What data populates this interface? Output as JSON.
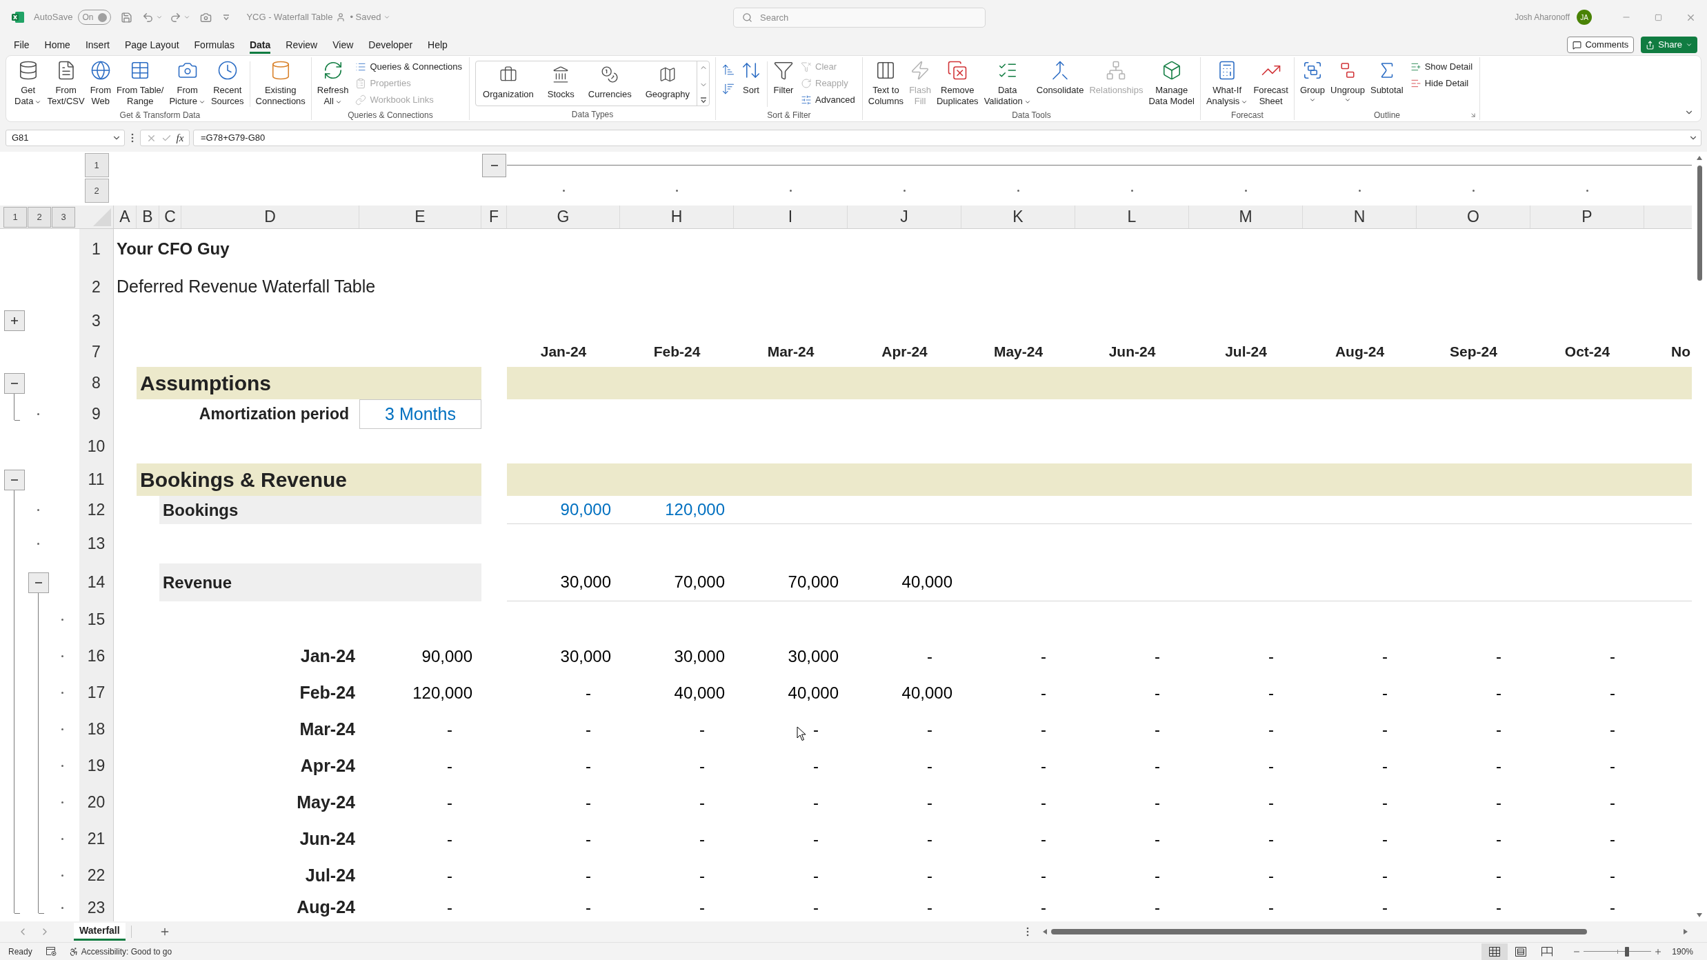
{
  "title_bar": {
    "autosave": {
      "label": "AutoSave",
      "state_text": "On",
      "on": true
    },
    "document_title": "YCG - Waterfall Table",
    "save_status": "• Saved",
    "search": {
      "placeholder": "Search"
    },
    "user_name": "Josh Aharonoff",
    "avatar_initials": "JA"
  },
  "menu_tabs": [
    {
      "label": "File",
      "selected": false
    },
    {
      "label": "Home",
      "selected": false
    },
    {
      "label": "Insert",
      "selected": false
    },
    {
      "label": "Page Layout",
      "selected": false
    },
    {
      "label": "Formulas",
      "selected": false
    },
    {
      "label": "Data",
      "selected": true
    },
    {
      "label": "Review",
      "selected": false
    },
    {
      "label": "View",
      "selected": false
    },
    {
      "label": "Developer",
      "selected": false
    },
    {
      "label": "Help",
      "selected": false
    }
  ],
  "header_buttons": {
    "comments": "Comments",
    "share": "Share"
  },
  "ribbon": {
    "groups": [
      {
        "label": "Get & Transform Data",
        "items": [
          {
            "kind": "large",
            "lines": [
              "Get",
              "Data"
            ],
            "dropdown": true,
            "disabled": false
          },
          {
            "kind": "large",
            "lines": [
              "From",
              "Text/CSV"
            ],
            "dropdown": false,
            "disabled": false
          },
          {
            "kind": "large",
            "lines": [
              "From",
              "Web"
            ],
            "dropdown": false,
            "disabled": false
          },
          {
            "kind": "large",
            "lines": [
              "From Table/",
              "Range"
            ],
            "dropdown": false,
            "disabled": false
          },
          {
            "kind": "large",
            "lines": [
              "From",
              "Picture"
            ],
            "dropdown": true,
            "disabled": false
          },
          {
            "kind": "large",
            "lines": [
              "Recent",
              "Sources"
            ],
            "dropdown": false,
            "disabled": false
          },
          {
            "kind": "separator"
          },
          {
            "kind": "large",
            "lines": [
              "Existing",
              "Connections"
            ],
            "dropdown": false,
            "disabled": false
          }
        ]
      },
      {
        "label": "Queries & Connections",
        "items": [
          {
            "kind": "large",
            "lines": [
              "Refresh",
              "All"
            ],
            "dropdown": true,
            "disabled": false
          },
          {
            "kind": "small_stack",
            "entries": [
              {
                "label": "Queries & Connections",
                "disabled": false
              },
              {
                "label": "Properties",
                "disabled": true
              },
              {
                "label": "Workbook Links",
                "disabled": true
              }
            ]
          }
        ]
      },
      {
        "label": "Data Types",
        "items": [
          {
            "kind": "gallery",
            "entries": [
              "Organization",
              "Stocks",
              "Currencies",
              "Geography"
            ]
          }
        ]
      },
      {
        "label": "Sort & Filter",
        "items": [
          {
            "kind": "sort_pair"
          },
          {
            "kind": "large",
            "lines": [
              "Sort"
            ],
            "dropdown": false,
            "disabled": false
          },
          {
            "kind": "separator"
          },
          {
            "kind": "large",
            "lines": [
              "Filter"
            ],
            "dropdown": false,
            "disabled": false
          },
          {
            "kind": "small_stack",
            "entries": [
              {
                "label": "Clear",
                "disabled": true
              },
              {
                "label": "Reapply",
                "disabled": true
              },
              {
                "label": "Advanced",
                "disabled": false
              }
            ]
          }
        ]
      },
      {
        "label": "Data Tools",
        "items": [
          {
            "kind": "large",
            "lines": [
              "Text to",
              "Columns"
            ],
            "dropdown": false,
            "disabled": false
          },
          {
            "kind": "large",
            "lines": [
              "Flash",
              "Fill"
            ],
            "dropdown": false,
            "disabled": true
          },
          {
            "kind": "large",
            "lines": [
              "Remove",
              "Duplicates"
            ],
            "dropdown": false,
            "disabled": false
          },
          {
            "kind": "large",
            "lines": [
              "Data",
              "Validation"
            ],
            "dropdown": true,
            "disabled": false
          },
          {
            "kind": "large",
            "lines": [
              "Consolidate"
            ],
            "dropdown": false,
            "disabled": false
          },
          {
            "kind": "large",
            "lines": [
              "Relationships"
            ],
            "dropdown": false,
            "disabled": true
          },
          {
            "kind": "large",
            "lines": [
              "Manage",
              "Data Model"
            ],
            "dropdown": false,
            "disabled": false
          }
        ]
      },
      {
        "label": "Forecast",
        "items": [
          {
            "kind": "large",
            "lines": [
              "What-If",
              "Analysis"
            ],
            "dropdown": true,
            "disabled": false
          },
          {
            "kind": "large",
            "lines": [
              "Forecast",
              "Sheet"
            ],
            "dropdown": false,
            "disabled": false
          }
        ]
      },
      {
        "label": "Outline",
        "dialog_launcher": true,
        "items": [
          {
            "kind": "large",
            "lines": [
              "Group"
            ],
            "dropdown": true,
            "disabled": false
          },
          {
            "kind": "large",
            "lines": [
              "Ungroup"
            ],
            "dropdown": true,
            "disabled": false
          },
          {
            "kind": "large",
            "lines": [
              "Subtotal"
            ],
            "dropdown": false,
            "disabled": false
          },
          {
            "kind": "small_stack",
            "entries": [
              {
                "label": "Show Detail",
                "disabled": false
              },
              {
                "label": "Hide Detail",
                "disabled": false
              }
            ]
          }
        ]
      }
    ]
  },
  "formula_bar": {
    "name_box": "G81",
    "function_label": "fx",
    "formula": "=G78+G79-G80"
  },
  "sheet": {
    "row_levels": [
      "1",
      "2",
      "3"
    ],
    "column_levels": [
      "1",
      "2"
    ],
    "columns": [
      {
        "label": "A"
      },
      {
        "label": "B"
      },
      {
        "label": "C"
      },
      {
        "label": "D"
      },
      {
        "label": "E"
      },
      {
        "label": "F",
        "expanded": true,
        "children": [
          {
            "label": "G"
          },
          {
            "label": "H"
          },
          {
            "label": "I"
          },
          {
            "label": "J"
          },
          {
            "label": "K"
          },
          {
            "label": "L"
          },
          {
            "label": "M"
          },
          {
            "label": "N"
          },
          {
            "label": "O"
          },
          {
            "label": "P"
          }
        ]
      }
    ],
    "rows": [
      {
        "number": "1",
        "kind": "title",
        "text": "Your CFO Guy"
      },
      {
        "number": "2",
        "kind": "subtitle",
        "text": "Deferred Revenue Waterfall Table"
      },
      {
        "number": "3",
        "kind": "blank",
        "expanded": false
      },
      {
        "number": "7",
        "kind": "months",
        "months": [
          "Jan-24",
          "Feb-24",
          "Mar-24",
          "Apr-24",
          "May-24",
          "Jun-24",
          "Jul-24",
          "Aug-24",
          "Sep-24",
          "Oct-24",
          "No"
        ]
      },
      {
        "number": "8",
        "kind": "section",
        "label": "Assumptions",
        "expanded": true,
        "children": [
          {
            "number": "9",
            "kind": "input",
            "label": "Amortization period",
            "value": "3 Months"
          }
        ]
      },
      {
        "number": "10",
        "kind": "blank"
      },
      {
        "number": "11",
        "kind": "section",
        "label": "Bookings & Revenue",
        "expanded": true,
        "children": [
          {
            "number": "12",
            "kind": "bookings",
            "label": "Bookings",
            "values": [
              "90,000",
              "120,000"
            ]
          },
          {
            "number": "13",
            "kind": "blank"
          },
          {
            "number": "14",
            "kind": "revenue",
            "label": "Revenue",
            "values": [
              "30,000",
              "70,000",
              "70,000",
              "40,000"
            ],
            "expanded": true,
            "children": [
              {
                "number": "15",
                "kind": "blank"
              },
              {
                "number": "16",
                "kind": "schedule",
                "label": "Jan-24",
                "booking": "90,000",
                "values": [
                  "30,000",
                  "30,000",
                  "30,000",
                  "-",
                  "-",
                  "-",
                  "-",
                  "-",
                  "-",
                  "-"
                ]
              },
              {
                "number": "17",
                "kind": "schedule",
                "label": "Feb-24",
                "booking": "120,000",
                "values": [
                  "-",
                  "40,000",
                  "40,000",
                  "40,000",
                  "-",
                  "-",
                  "-",
                  "-",
                  "-",
                  "-"
                ]
              },
              {
                "number": "18",
                "kind": "schedule",
                "label": "Mar-24",
                "booking": "-",
                "values": [
                  "-",
                  "-",
                  "-",
                  "-",
                  "-",
                  "-",
                  "-",
                  "-",
                  "-",
                  "-"
                ]
              },
              {
                "number": "19",
                "kind": "schedule",
                "label": "Apr-24",
                "booking": "-",
                "values": [
                  "-",
                  "-",
                  "-",
                  "-",
                  "-",
                  "-",
                  "-",
                  "-",
                  "-",
                  "-"
                ]
              },
              {
                "number": "20",
                "kind": "schedule",
                "label": "May-24",
                "booking": "-",
                "values": [
                  "-",
                  "-",
                  "-",
                  "-",
                  "-",
                  "-",
                  "-",
                  "-",
                  "-",
                  "-"
                ]
              },
              {
                "number": "21",
                "kind": "schedule",
                "label": "Jun-24",
                "booking": "-",
                "values": [
                  "-",
                  "-",
                  "-",
                  "-",
                  "-",
                  "-",
                  "-",
                  "-",
                  "-",
                  "-"
                ]
              },
              {
                "number": "22",
                "kind": "schedule",
                "label": "Jul-24",
                "booking": "-",
                "values": [
                  "-",
                  "-",
                  "-",
                  "-",
                  "-",
                  "-",
                  "-",
                  "-",
                  "-",
                  "-"
                ]
              },
              {
                "number": "23",
                "kind": "schedule",
                "label": "Aug-24",
                "booking": "-",
                "values": [
                  "-",
                  "-",
                  "-",
                  "-",
                  "-",
                  "-",
                  "-",
                  "-",
                  "-",
                  "-"
                ]
              }
            ]
          }
        ]
      }
    ]
  },
  "sheet_tabs": [
    {
      "label": "Waterfall",
      "selected": true
    }
  ],
  "status_bar": {
    "mode": "Ready",
    "accessibility": "Accessibility: Good to go",
    "views": [
      {
        "kind": "normal",
        "selected": true
      },
      {
        "kind": "page_layout",
        "selected": false
      },
      {
        "kind": "page_break",
        "selected": false
      }
    ],
    "zoom": {
      "level": 0.64,
      "reading": "190%"
    }
  }
}
